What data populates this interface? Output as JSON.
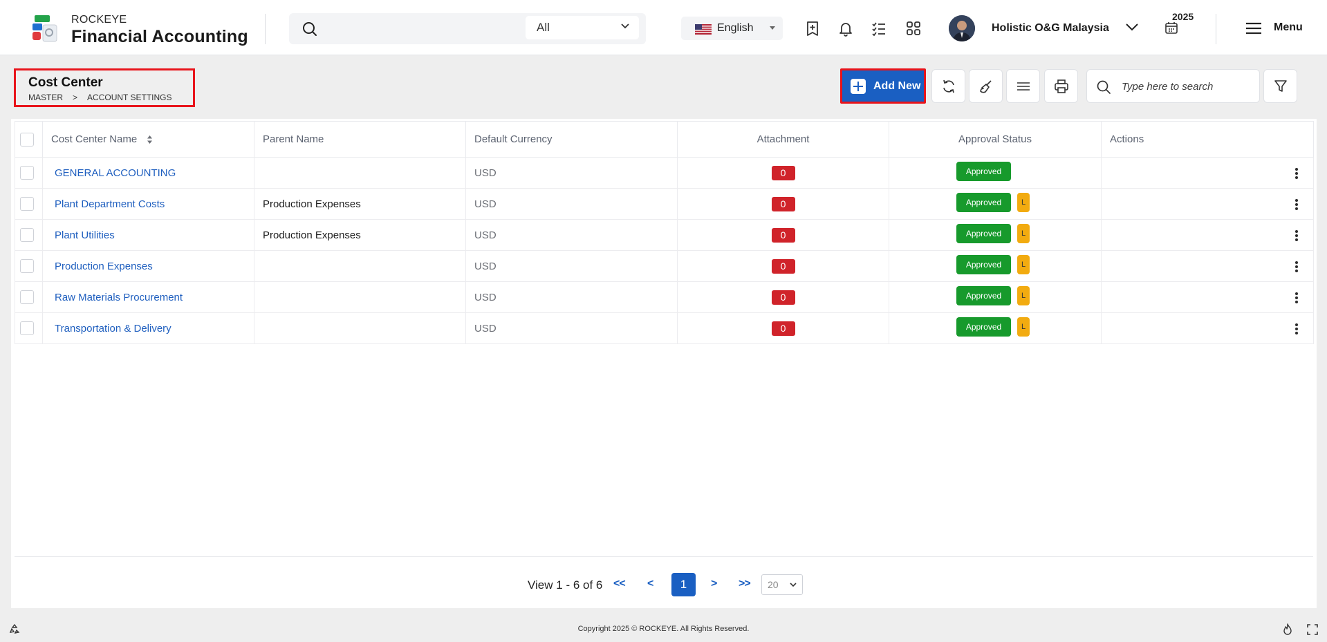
{
  "app": {
    "brand_top": "ROCKEYE",
    "brand_main": "Financial Accounting"
  },
  "header": {
    "search_scope": "All",
    "language": "English",
    "company": "Holistic O&G Malaysia",
    "year": "2025",
    "menu_label": "Menu",
    "icons": [
      "search-icon",
      "bookmark-add-icon",
      "bell-icon",
      "checklist-icon",
      "apps-grid-icon",
      "calendar-icon",
      "hamburger-menu-icon"
    ]
  },
  "page": {
    "title": "Cost Center",
    "breadcrumb": [
      "MASTER",
      ">",
      "ACCOUNT SETTINGS"
    ]
  },
  "toolbar": {
    "add_new_label": "Add New",
    "search_placeholder": "Type here to search"
  },
  "table": {
    "columns": [
      "Cost Center Name",
      "Parent Name",
      "Default Currency",
      "Attachment",
      "Approval Status",
      "Actions"
    ],
    "rows": [
      {
        "name": "GENERAL ACCOUNTING",
        "parent": "",
        "currency": "USD",
        "attachments": "0",
        "status": "Approved",
        "lock": ""
      },
      {
        "name": "Plant Department Costs",
        "parent": "Production Expenses",
        "currency": "USD",
        "attachments": "0",
        "status": "Approved",
        "lock": "L"
      },
      {
        "name": "Plant Utilities",
        "parent": "Production Expenses",
        "currency": "USD",
        "attachments": "0",
        "status": "Approved",
        "lock": "L"
      },
      {
        "name": "Production Expenses",
        "parent": "",
        "currency": "USD",
        "attachments": "0",
        "status": "Approved",
        "lock": "L"
      },
      {
        "name": "Raw Materials Procurement",
        "parent": "",
        "currency": "USD",
        "attachments": "0",
        "status": "Approved",
        "lock": "L"
      },
      {
        "name": "Transportation & Delivery",
        "parent": "",
        "currency": "USD",
        "attachments": "0",
        "status": "Approved",
        "lock": "L"
      }
    ]
  },
  "pagination": {
    "info": "View 1 - 6 of 6",
    "first": "<<",
    "prev": "<",
    "current": "1",
    "next": ">",
    "last": ">>",
    "page_size": "20"
  },
  "footer": {
    "copyright": "Copyright 2025 © ROCKEYE. All Rights Reserved."
  },
  "colors": {
    "primary": "#1a5fc2",
    "highlight_border": "#e8141b",
    "approved": "#179a2c",
    "lock": "#f2ab10",
    "attachment": "#d0232a"
  }
}
